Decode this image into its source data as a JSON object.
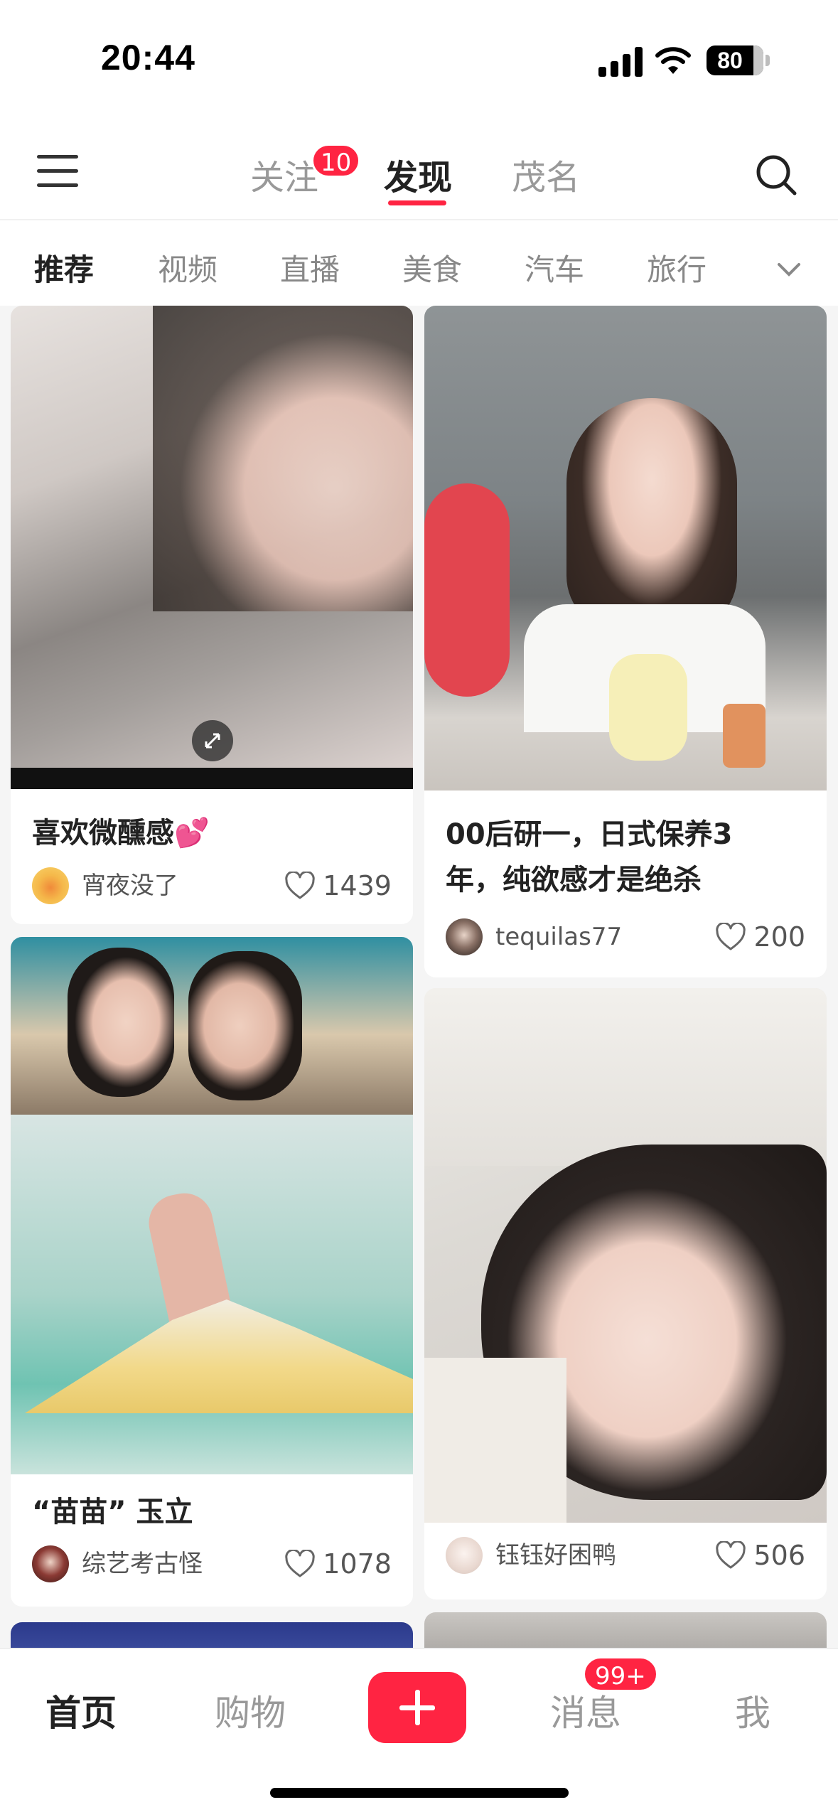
{
  "status_bar": {
    "time": "20:44",
    "battery": "80"
  },
  "top_nav": {
    "tabs": [
      {
        "label": "关注",
        "badge": "10"
      },
      {
        "label": "发现"
      },
      {
        "label": "茂名"
      }
    ],
    "active_tab": "发现"
  },
  "categories": [
    "推荐",
    "视频",
    "直播",
    "美食",
    "汽车",
    "旅行"
  ],
  "feed": [
    {
      "title": "喜欢微醺感💕",
      "author": "宵夜没了",
      "likes": "1439"
    },
    {
      "title_lines": [
        "00后研一，日式保养3",
        "年，纯欲感才是绝杀"
      ],
      "author": "tequilas77",
      "likes": "200"
    },
    {
      "title": "“苗苗” 玉立",
      "author": "综艺考古怪",
      "likes": "1078"
    },
    {
      "title": "",
      "author": "钰钰好困鸭",
      "likes": "506"
    }
  ],
  "bottom_nav": {
    "tabs": [
      "首页",
      "购物",
      "消息",
      "我"
    ],
    "message_badge": "99+"
  },
  "icons": [
    "menu-icon",
    "search-icon",
    "chevron-down-icon",
    "heart-icon",
    "plus-icon",
    "expand-icon"
  ],
  "colors": {
    "accent": "#ff2442"
  }
}
